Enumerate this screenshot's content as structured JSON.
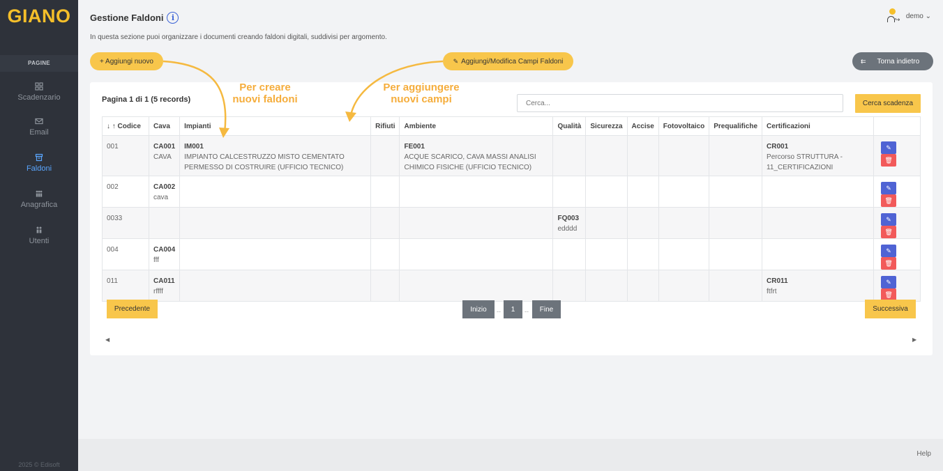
{
  "app": {
    "logo": "GIANO",
    "copyright": "2025 © Edisoft"
  },
  "sidebar": {
    "section": "PAGINE",
    "items": [
      {
        "label": "Scadenzario",
        "icon": "grid-icon"
      },
      {
        "label": "Email",
        "icon": "mail-icon"
      },
      {
        "label": "Faldoni",
        "icon": "archive-icon",
        "active": true
      },
      {
        "label": "Anagrafica",
        "icon": "people-icon"
      },
      {
        "label": "Utenti",
        "icon": "users-icon"
      }
    ]
  },
  "header": {
    "title": "Gestione Faldoni",
    "description": "In questa sezione puoi organizzare i documenti creando faldoni digitali, suddivisi per argomento.",
    "user": "demo ⌄"
  },
  "toolbar": {
    "add_new": "+ Aggiungi nuovo",
    "edit_fields": "Aggiungi/Modifica Campi Faldoni",
    "back": "Torna indietro"
  },
  "annotations": {
    "create_line1": "Per creare",
    "create_line2": "nuovi faldoni",
    "add_line1": "Per aggiungere",
    "add_line2": "nuovi campi"
  },
  "list": {
    "records": "Pagina 1 di 1 (5 records)",
    "search_placeholder": "Cerca...",
    "search_button": "Cerca scadenza",
    "columns": [
      "↓ ↑ Codice",
      "Cava",
      "Impianti",
      "Rifiuti",
      "Ambiente",
      "Qualità",
      "Sicurezza",
      "Accise",
      "Fotovoltaico",
      "Prequalifiche",
      "Certificazioni",
      ""
    ],
    "rows": [
      {
        "codice": "001",
        "cava_code": "CA001",
        "cava_desc": "CAVA",
        "imp_code": "IM001",
        "imp_desc1": "IMPIANTO CALCESTRUZZO MISTO CEMENTATO",
        "imp_desc2": "PERMESSO DI COSTRUIRE (UFFICIO TECNICO)",
        "amb_code": "FE001",
        "amb_desc1": "ACQUE SCARICO, CAVA MASSI ANALISI",
        "amb_desc2": "CHIMICO FISICHE (UFFICIO TECNICO)",
        "qual_code": "",
        "qual_desc": "",
        "cert_code": "CR001",
        "cert_desc1": "Percorso STRUTTURA -",
        "cert_desc2": "11_CERTIFICAZIONI"
      },
      {
        "codice": "002",
        "cava_code": "CA002",
        "cava_desc": "cava",
        "imp_code": "",
        "imp_desc1": "",
        "imp_desc2": "",
        "amb_code": "",
        "amb_desc1": "",
        "amb_desc2": "",
        "qual_code": "",
        "qual_desc": "",
        "cert_code": "",
        "cert_desc1": "",
        "cert_desc2": ""
      },
      {
        "codice": "0033",
        "cava_code": "",
        "cava_desc": "",
        "imp_code": "",
        "imp_desc1": "",
        "imp_desc2": "",
        "amb_code": "",
        "amb_desc1": "",
        "amb_desc2": "",
        "qual_code": "FQ003",
        "qual_desc": "edddd",
        "cert_code": "",
        "cert_desc1": "",
        "cert_desc2": ""
      },
      {
        "codice": "004",
        "cava_code": "CA004",
        "cava_desc": "fff",
        "imp_code": "",
        "imp_desc1": "",
        "imp_desc2": "",
        "amb_code": "",
        "amb_desc1": "",
        "amb_desc2": "",
        "qual_code": "",
        "qual_desc": "",
        "cert_code": "",
        "cert_desc1": "",
        "cert_desc2": ""
      },
      {
        "codice": "011",
        "cava_code": "CA011",
        "cava_desc": "rffff",
        "imp_code": "",
        "imp_desc1": "",
        "imp_desc2": "",
        "amb_code": "",
        "amb_desc1": "",
        "amb_desc2": "",
        "qual_code": "",
        "qual_desc": "",
        "cert_code": "CR011",
        "cert_desc1": "ftfrt",
        "cert_desc2": ""
      }
    ],
    "edit_icon": "edit-icon",
    "delete_icon": "trash-icon"
  },
  "pagination": {
    "prev": "Precedente",
    "first": "Inizio",
    "sep1": "--",
    "page": "1",
    "sep2": "--",
    "last": "Fine",
    "next": "Successiva"
  },
  "footer": {
    "help": "Help"
  },
  "colors": {
    "accent": "#f8c64b",
    "sidebar": "#2e323a",
    "active": "#5aa6ff",
    "edit": "#4f63d4",
    "delete": "#f25a5a",
    "annotation": "#f5ad3c"
  }
}
